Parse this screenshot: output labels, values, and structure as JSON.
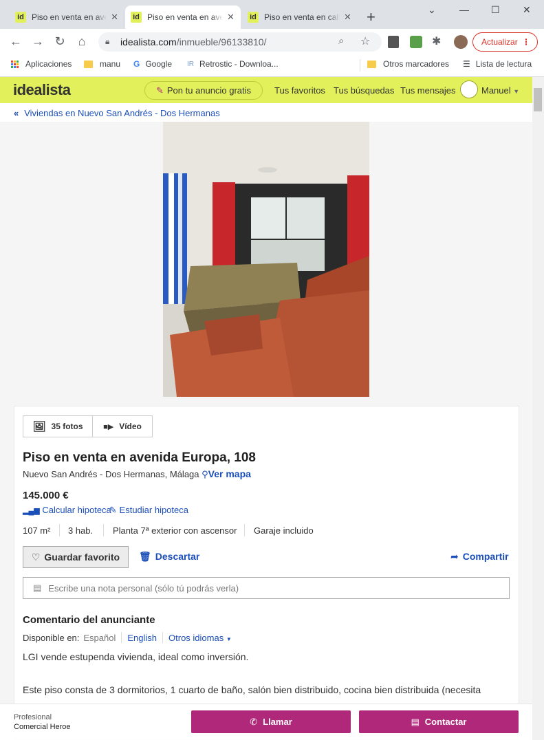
{
  "browser": {
    "tabs": [
      {
        "title": "Piso en venta en avenida Europa"
      },
      {
        "title": "Piso en venta en avenida Europa"
      },
      {
        "title": "Piso en venta en calle"
      }
    ],
    "fav_glyph": "id",
    "url_domain": "idealista.com",
    "url_path": "/inmueble/96133810/",
    "update_label": "Actualizar",
    "bookmarks": [
      "Aplicaciones",
      "manu",
      "Google",
      "Retrostic - Downloa...",
      "Otros marcadores",
      "Lista de lectura"
    ]
  },
  "site": {
    "logo": "idealista",
    "publish_label": "Pon tu anuncio gratis",
    "nav": [
      "Tus favoritos",
      "Tus búsquedas",
      "Tus mensajes"
    ],
    "user_name": "Manuel",
    "breadcrumb": "Viviendas en Nuevo San Andrés - Dos Hermanas"
  },
  "listing": {
    "photos_label": "35 fotos",
    "video_label": "Vídeo",
    "title": "Piso en venta en avenida Europa, 108",
    "location": "Nuevo San Andrés - Dos Hermanas, Málaga",
    "map_label": "Ver mapa",
    "price": "145.000 €",
    "calc_label": "Calcular hipoteca",
    "study_label": "Estudiar hipoteca",
    "features": [
      "107 m²",
      "3 hab.",
      "Planta 7ª exterior con ascensor",
      "Garaje incluido"
    ],
    "save_label": "Guardar favorito",
    "discard_label": "Descartar",
    "share_label": "Compartir",
    "note_placeholder": "Escribe una nota personal (sólo tú podrás verla)",
    "comment_heading": "Comentario del anunciante",
    "available_label": "Disponible en:",
    "lang_current": "Español",
    "lang_english": "English",
    "lang_other": "Otros idiomas",
    "desc_1": "LGI vende estupenda vivienda, ideal como inversión.",
    "desc_2": "Este piso consta de 3 dormitorios, 1 cuarto de baño, salón bien distribuido, cocina bien distribuida (necesita"
  },
  "contact": {
    "role": "Profesional",
    "agency": "Comercial Heroe",
    "call_label": "Llamar",
    "contact_label": "Contactar"
  },
  "colors": {
    "brand_yellow": "#e1f05b",
    "link_blue": "#1a4eb8",
    "cta_magenta": "#b0287a"
  }
}
